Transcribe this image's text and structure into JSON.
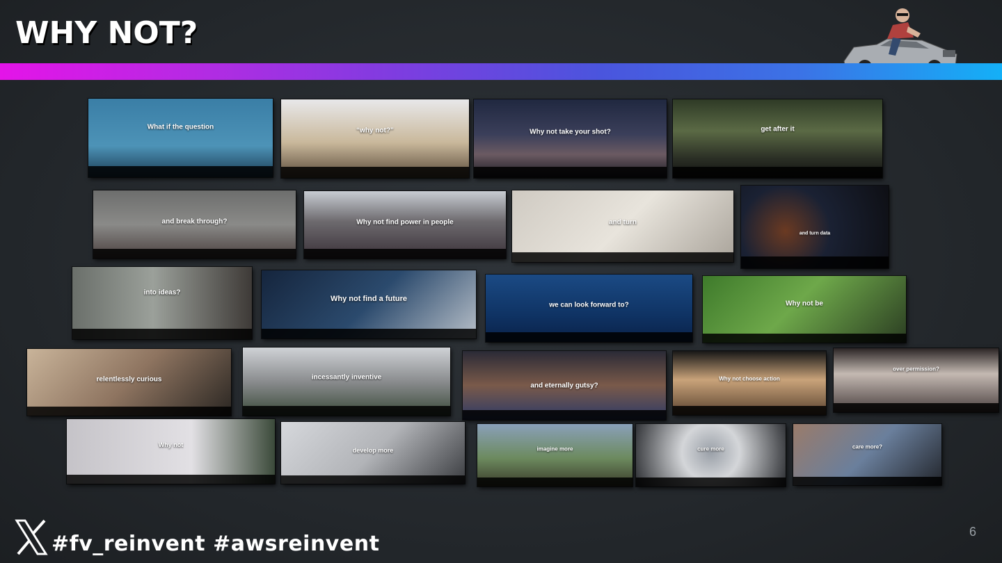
{
  "slide": {
    "title": "WHY NOT?",
    "page_number": "6",
    "hashtags": "#fv_reinvent #awsreinvent"
  },
  "colors": {
    "gradient_bar": [
      "#e414e8",
      "#7d3de0",
      "#3b73e6",
      "#14b0f7"
    ],
    "background": "#272b2f"
  },
  "icons": [
    "x-logo-icon",
    "delorean-driver-avatar"
  ],
  "tiles": [
    {
      "caption": "What if the question"
    },
    {
      "caption": "“why not?”"
    },
    {
      "caption": "Why not take your shot?"
    },
    {
      "caption": "get after it"
    },
    {
      "caption": "and break through?"
    },
    {
      "caption": "Why not find power in people"
    },
    {
      "caption": "and turn"
    },
    {
      "caption": "and turn data"
    },
    {
      "caption": "into ideas?"
    },
    {
      "caption": "Why not find a future"
    },
    {
      "caption": "we can look forward to?"
    },
    {
      "caption": "Why not be"
    },
    {
      "caption": "relentlessly curious"
    },
    {
      "caption": "incessantly inventive"
    },
    {
      "caption": "and eternally gutsy?"
    },
    {
      "caption": "Why not choose action"
    },
    {
      "caption": "over permission?"
    },
    {
      "caption": "Why not"
    },
    {
      "caption": "develop more"
    },
    {
      "caption": "imagine more"
    },
    {
      "caption": "cure more"
    },
    {
      "caption": "care more?"
    }
  ]
}
